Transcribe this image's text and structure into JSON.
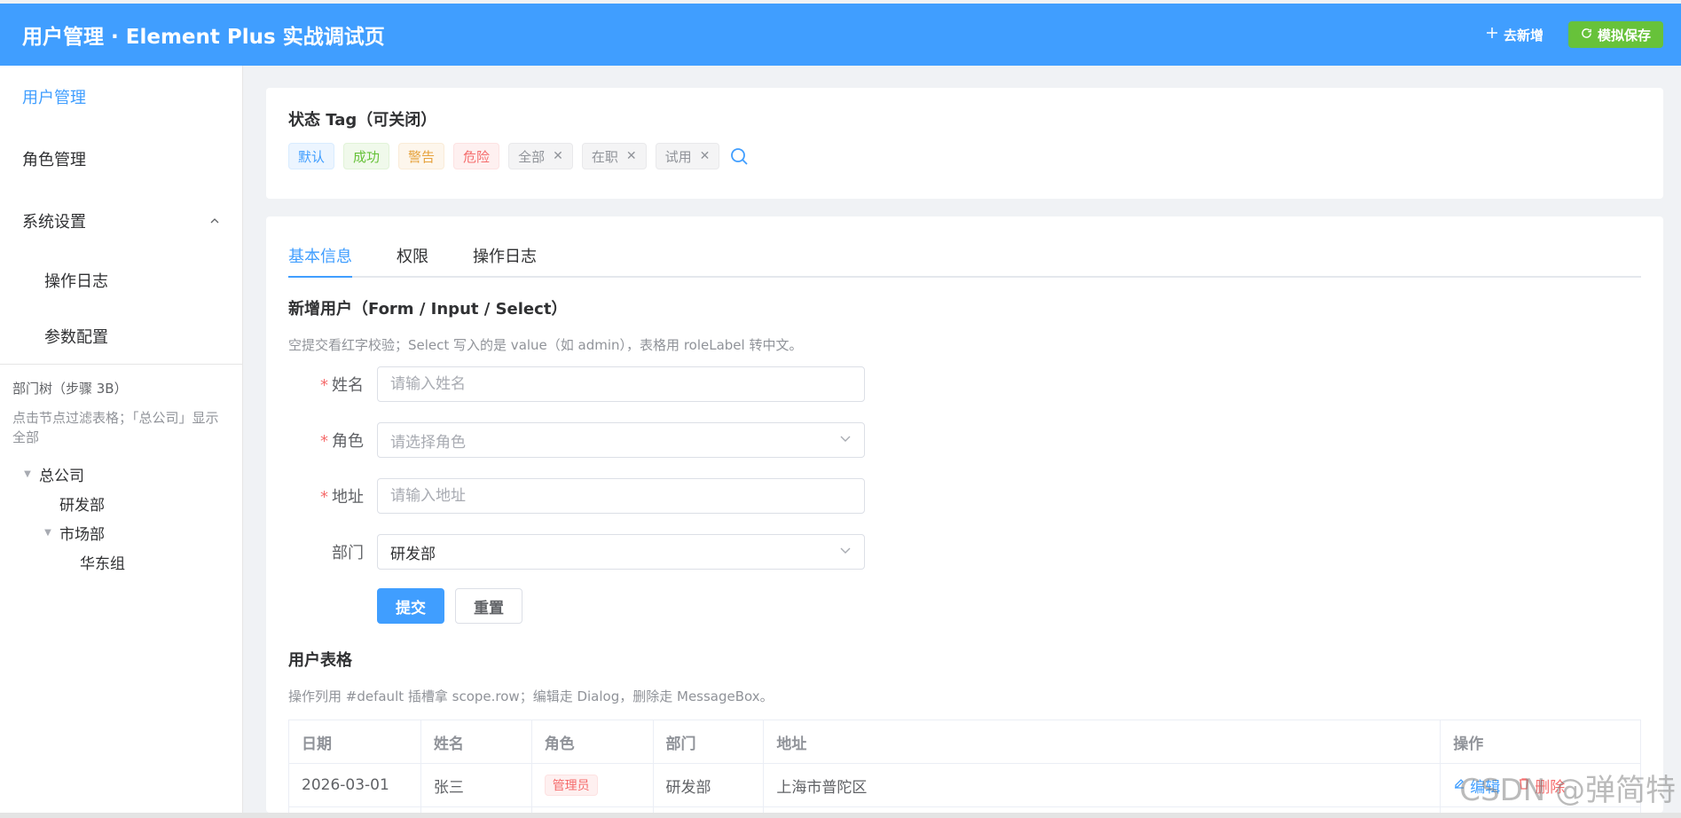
{
  "header": {
    "title": "用户管理 · Element Plus 实战调试页",
    "new_label": "去新增",
    "save_label": "模拟保存"
  },
  "sidebar": {
    "items": [
      {
        "label": "用户管理"
      },
      {
        "label": "角色管理"
      }
    ],
    "submenu": {
      "title": "系统设置",
      "items": [
        {
          "label": "操作日志"
        },
        {
          "label": "参数配置"
        }
      ]
    },
    "tree": {
      "title": "部门树（步骤 3B）",
      "hint": "点击节点过滤表格；「总公司」显示全部",
      "nodes": {
        "root": "总公司",
        "rd": "研发部",
        "market": "市场部",
        "east": "华东组"
      }
    }
  },
  "tags_card": {
    "title": "状态 Tag（可关闭）",
    "tags": [
      "默认",
      "成功",
      "警告",
      "危险",
      "全部",
      "在职",
      "试用"
    ]
  },
  "tabs": [
    "基本信息",
    "权限",
    "操作日志"
  ],
  "form": {
    "title": "新增用户（Form / Input / Select）",
    "desc": "空提交看红字校验；Select 写入的是 value（如 admin），表格用 roleLabel 转中文。",
    "name_label": "姓名",
    "name_placeholder": "请输入姓名",
    "role_label": "角色",
    "role_placeholder": "请选择角色",
    "address_label": "地址",
    "address_placeholder": "请输入地址",
    "dept_label": "部门",
    "dept_value": "研发部",
    "submit_label": "提交",
    "reset_label": "重置"
  },
  "table": {
    "title": "用户表格",
    "desc": "操作列用 #default 插槽拿 scope.row；编辑走 Dialog，删除走 MessageBox。",
    "headers": [
      "日期",
      "姓名",
      "角色",
      "部门",
      "地址",
      "操作"
    ],
    "rows": [
      {
        "date": "2026-03-01",
        "name": "张三",
        "role": "管理员",
        "dept": "研发部",
        "address": "上海市普陀区",
        "edit": "编辑",
        "delete": "删除"
      }
    ]
  },
  "watermark": "CSDN @弹简特",
  "colors": {
    "primary": "#409eff",
    "success": "#67c23a",
    "warning": "#e6a23c",
    "danger": "#f56c6c"
  }
}
